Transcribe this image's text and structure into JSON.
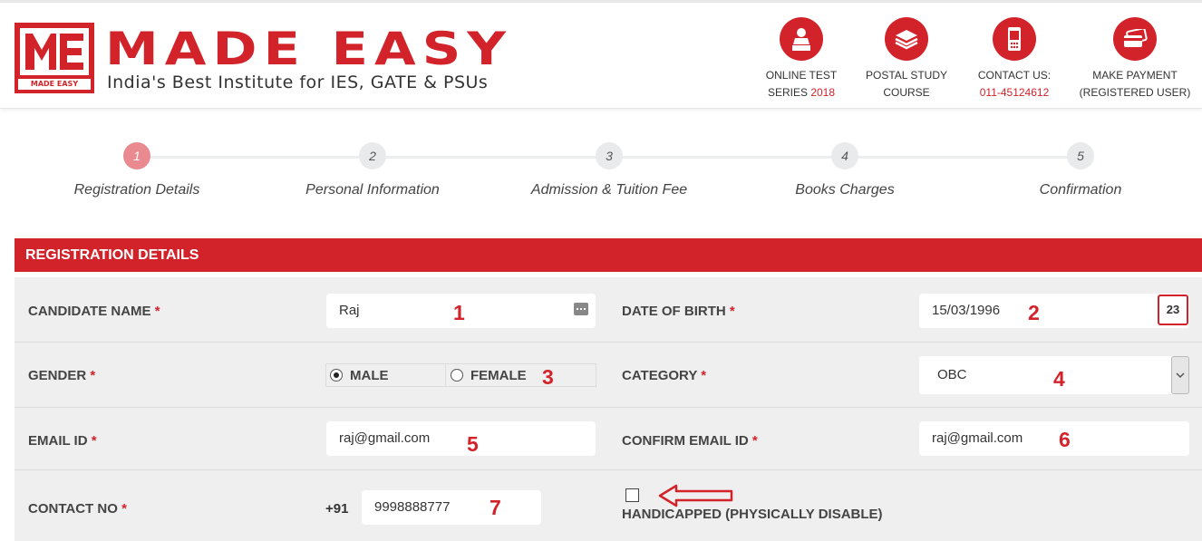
{
  "header": {
    "brand": "MADE EASY",
    "logo_caption": "MADE EASY",
    "tagline": "India's Best Institute for IES, GATE & PSUs",
    "buttons": [
      {
        "line1": "ONLINE TEST",
        "line2a": "SERIES ",
        "line2b": "2018",
        "icon": "test-person-icon"
      },
      {
        "line1": "POSTAL STUDY",
        "line2a": "COURSE",
        "line2b": "",
        "icon": "books-stack-icon"
      },
      {
        "line1": "CONTACT US:",
        "line2a": "",
        "line2b": "011-45124612",
        "icon": "mobile-phone-icon"
      },
      {
        "line1": "MAKE PAYMENT",
        "line2a": "(REGISTERED USER)",
        "line2b": "",
        "icon": "credit-card-icon"
      }
    ]
  },
  "steps": [
    {
      "num": "1",
      "label": "Registration Details",
      "active": true
    },
    {
      "num": "2",
      "label": "Personal Information",
      "active": false
    },
    {
      "num": "3",
      "label": "Admission & Tuition Fee",
      "active": false
    },
    {
      "num": "4",
      "label": "Books Charges",
      "active": false
    },
    {
      "num": "5",
      "label": "Confirmation",
      "active": false
    }
  ],
  "section_title": "REGISTRATION DETAILS",
  "form": {
    "candidate_name": {
      "label": "CANDIDATE NAME",
      "value": "Raj"
    },
    "date_of_birth": {
      "label": "DATE OF BIRTH",
      "value": "15/03/1996",
      "calendar_day": "23"
    },
    "gender": {
      "label": "GENDER",
      "options": [
        "MALE",
        "FEMALE"
      ],
      "selected": "MALE"
    },
    "category": {
      "label": "CATEGORY",
      "value": "OBC"
    },
    "email": {
      "label": "EMAIL ID",
      "value": "raj@gmail.com"
    },
    "confirm_email": {
      "label": "CONFIRM EMAIL ID",
      "value": "raj@gmail.com"
    },
    "contact": {
      "label": "CONTACT NO",
      "prefix": "+91",
      "value": "9998888777"
    },
    "handicapped": {
      "label": "HANDICAPPED (PHYSICALLY DISABLE)",
      "checked": false
    },
    "required_mark": "*"
  },
  "annotations": [
    "1",
    "2",
    "3",
    "4",
    "5",
    "6",
    "7"
  ],
  "colors": {
    "brand_red": "#d2232a",
    "step_active": "#e88a90",
    "form_bg": "#efefef"
  }
}
